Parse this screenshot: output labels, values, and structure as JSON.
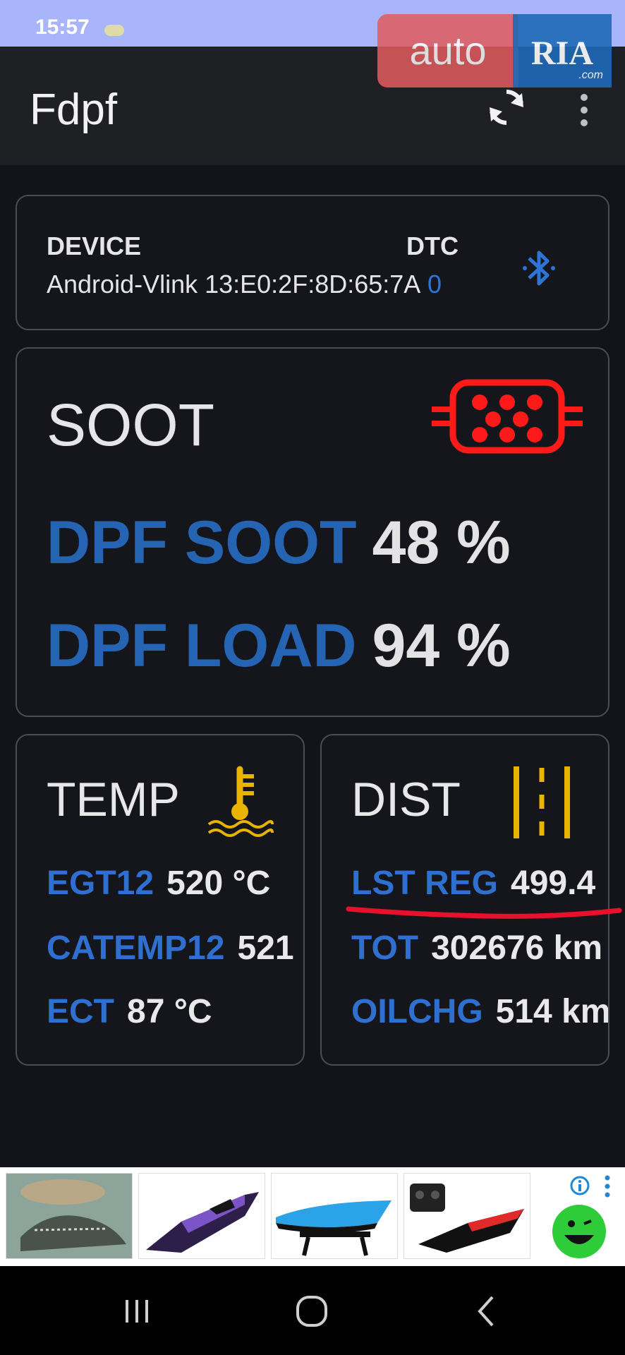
{
  "status_bar": {
    "time": "15:57"
  },
  "watermark": {
    "brand_part1": "auto",
    "brand_part2": "RIA",
    "suffix": ".com"
  },
  "app_bar": {
    "title": "Fdpf",
    "refresh_icon": "refresh-icon",
    "menu_icon": "more-vert-icon"
  },
  "device": {
    "device_label": "DEVICE",
    "device_value": "Android-Vlink 13:E0:2F:8D:65:7A",
    "dtc_label": "DTC",
    "dtc_value": "0",
    "icon": "bluetooth-icon"
  },
  "soot": {
    "title": "SOOT",
    "icon": "dpf-filter-icon",
    "soot_label": "DPF SOOT",
    "soot_value": "48 %",
    "load_label": "DPF LOAD",
    "load_value": "94 %"
  },
  "temp": {
    "title": "TEMP",
    "icon": "coolant-temperature-icon",
    "rows": [
      {
        "label": "EGT12",
        "value": "520 °C"
      },
      {
        "label": "CATEMP12",
        "value": "521"
      },
      {
        "label": "ECT",
        "value": "87 °C"
      }
    ]
  },
  "dist": {
    "title": "DIST",
    "icon": "road-lanes-icon",
    "rows": [
      {
        "label": "LST REG",
        "value": "499.4"
      },
      {
        "label": "TOT",
        "value": "302676 km"
      },
      {
        "label": "OILCHG",
        "value": "514 km"
      }
    ]
  },
  "ad_bar": {
    "items": [
      "crocodile-boat-toy",
      "purple-speed-boat",
      "blue-rc-boat",
      "red-rc-boat-with-remote"
    ],
    "info_icon": "info-icon",
    "more_icon": "more-vert-icon",
    "smile_icon": "smiley-logo-icon"
  },
  "nav_bar": {
    "recent": "recent-apps-icon",
    "home": "home-icon",
    "back": "back-icon"
  },
  "colors": {
    "accent_blue": "#2e74d6",
    "alert_red": "#ff1a1a",
    "gauge_yellow": "#e8b400",
    "background": "#131419"
  }
}
